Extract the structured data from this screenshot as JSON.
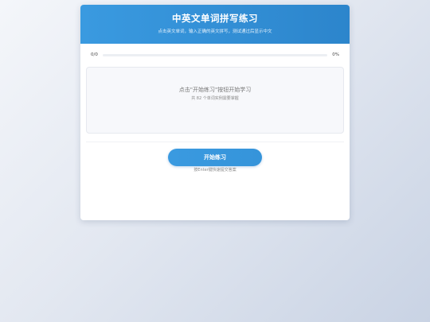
{
  "header": {
    "title": "中英文单词拼写练习",
    "subtitle": "点击英文单词，输入正确的英文拼写，测试通过后显示中文"
  },
  "progress": {
    "count_label": "0/0",
    "percent_label": "0%",
    "fraction": 0
  },
  "practice": {
    "prompt": "点击\"开始练习\"按钮开始学习",
    "word_count_text": "共 82 个单词实例需要掌握"
  },
  "actions": {
    "start_label": "开始练习",
    "hint": "按Enter键快速提交答案"
  },
  "colors": {
    "accent": "#3a9ae0",
    "header_start": "#3a9ae0",
    "header_end": "#2c85cc"
  }
}
